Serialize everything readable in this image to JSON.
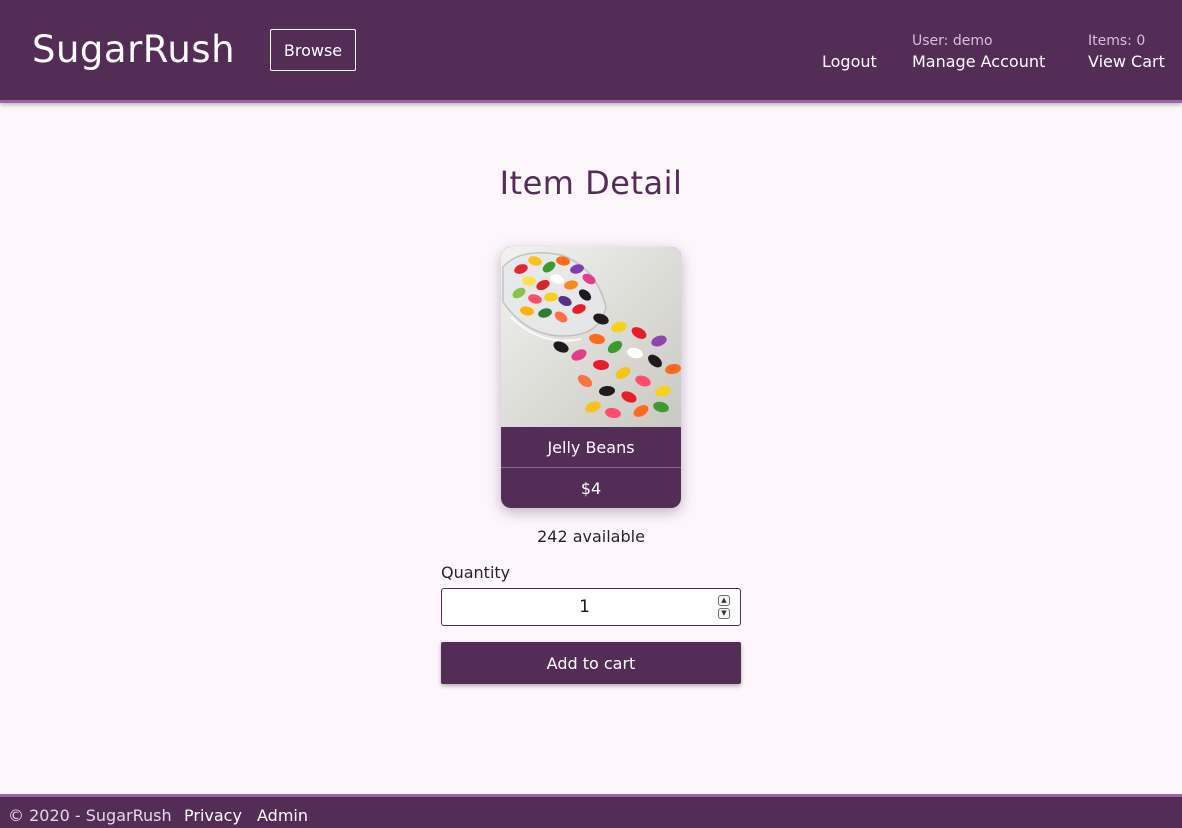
{
  "header": {
    "brand": "SugarRush",
    "browse_label": "Browse",
    "logout_label": "Logout",
    "user_text": "User: demo",
    "manage_account_label": "Manage Account",
    "items_text": "Items: 0",
    "view_cart_label": "View Cart"
  },
  "main": {
    "title": "Item Detail",
    "item": {
      "name": "Jelly Beans",
      "price": "$4",
      "image": "jelly-beans-photo"
    },
    "available_text": "242 available",
    "quantity_label": "Quantity",
    "quantity_value": "1",
    "add_to_cart_label": "Add to cart"
  },
  "footer": {
    "copyright": "© 2020 - SugarRush",
    "privacy_label": "Privacy",
    "admin_label": "Admin"
  },
  "colors": {
    "brand": "#532d55",
    "accent": "#9c65a0",
    "background": "#fdf7fc"
  }
}
